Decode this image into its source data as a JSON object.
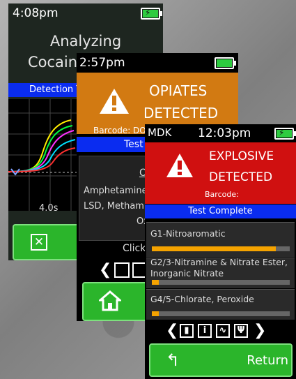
{
  "screen1": {
    "time": "4:08pm",
    "title_line1": "Analyzing",
    "title_line2": "Cocaine",
    "status_bar": "Detection T",
    "x_tick": "4.0s",
    "battery_charging": true
  },
  "screen2": {
    "time": "2:57pm",
    "alert_line1": "OPIATES",
    "alert_line2": "DETECTED",
    "barcode_label": "Barcode: DO",
    "status_bar": "Test",
    "result_heading": "O",
    "result_line1": "Amphetamine",
    "result_line2": "LSD, Methamp",
    "result_line3": "Oxy",
    "click_text": "Click"
  },
  "screen3": {
    "user": "MDK",
    "time": "12:03pm",
    "alert_line1": "EXPLOSIVE",
    "alert_line2": "DETECTED",
    "barcode_label": "Barcode:",
    "status_bar": "Test Complete",
    "results": [
      {
        "label": "G1-Nitroaromatic",
        "level": 0.9
      },
      {
        "label": "G2/3-Nitramine & Nitrate Ester, Inorganic Nitrate",
        "level": 0.05
      },
      {
        "label": "G4/5-Chlorate, Peroxide",
        "level": 0.05
      }
    ],
    "return_label": "Return"
  },
  "colors": {
    "explosive_red": "#d01010",
    "opiates_orange": "#d27a12",
    "status_blue": "#0a2cf0",
    "button_green": "#2bb52b",
    "level_bar": "#f5a300"
  }
}
